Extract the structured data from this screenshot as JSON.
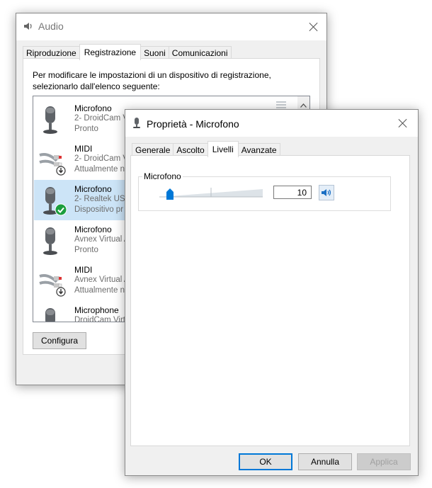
{
  "audio_window": {
    "title": "Audio",
    "tabs": [
      {
        "label": "Riproduzione",
        "active": false
      },
      {
        "label": "Registrazione",
        "active": true
      },
      {
        "label": "Suoni",
        "active": false
      },
      {
        "label": "Comunicazioni",
        "active": false
      }
    ],
    "instruction": "Per modificare le impostazioni di un dispositivo di registrazione, selezionarlo dall'elenco seguente:",
    "devices": [
      {
        "name": "Microfono",
        "desc": "2- DroidCam V",
        "status": "Pronto",
        "icon": "microphone-icon",
        "selected": false
      },
      {
        "name": "MIDI",
        "desc": "2- DroidCam V",
        "status": "Attualmente no",
        "icon": "midi-cable-icon",
        "selected": false
      },
      {
        "name": "Microfono",
        "desc": "2- Realtek USB",
        "status": "Dispositivo pr",
        "icon": "microphone-icon",
        "selected": true
      },
      {
        "name": "Microfono",
        "desc": "Avnex Virtual A",
        "status": "Pronto",
        "icon": "microphone-icon",
        "selected": false
      },
      {
        "name": "MIDI",
        "desc": "Avnex Virtual A",
        "status": "Attualmente no",
        "icon": "midi-cable-icon",
        "selected": false
      },
      {
        "name": "Microphone",
        "desc": "DroidCam Virt",
        "status": "",
        "icon": "microphone-icon",
        "selected": false
      }
    ],
    "configure_label": "Configura"
  },
  "properties_window": {
    "title": "Proprietà - Microfono",
    "tabs": [
      {
        "label": "Generale",
        "active": false
      },
      {
        "label": "Ascolto",
        "active": false
      },
      {
        "label": "Livelli",
        "active": true
      },
      {
        "label": "Avanzate",
        "active": false
      }
    ],
    "level_group_label": "Microfono",
    "level_value": "10",
    "level_fraction": 0.1,
    "ok_label": "OK",
    "cancel_label": "Annulla",
    "apply_label": "Applica",
    "accent_color": "#0078d7"
  }
}
